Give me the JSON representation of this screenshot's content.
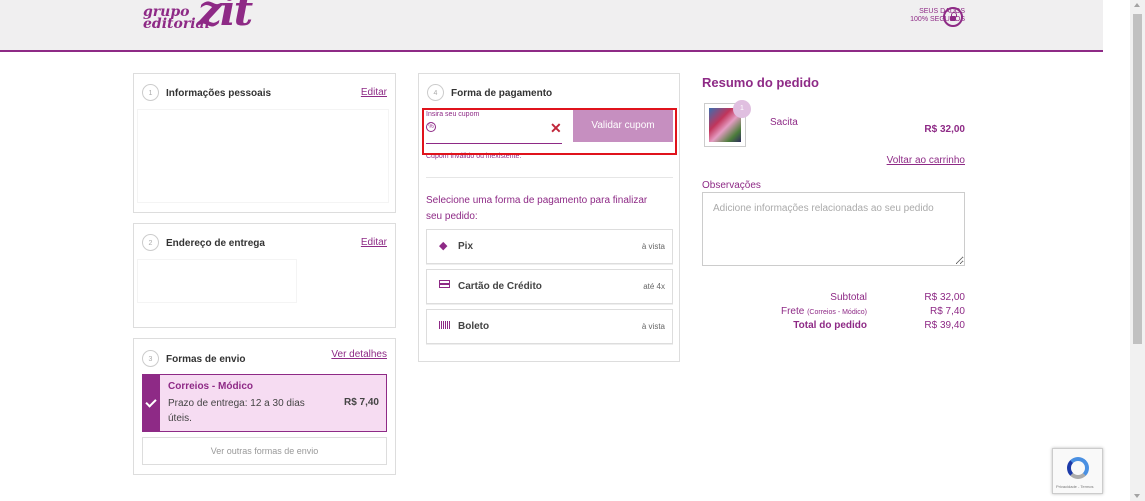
{
  "header": {
    "logo_small_1": "grupo",
    "logo_small_2": "editorial",
    "logo_big": "zit",
    "secure_line1": "SEUS DADOS",
    "secure_line2": "100% SEGUROS"
  },
  "personal": {
    "step": "1",
    "title": "Informações pessoais",
    "edit": "Editar"
  },
  "address": {
    "step": "2",
    "title": "Endereço de entrega",
    "edit": "Editar"
  },
  "shipping": {
    "step": "3",
    "title": "Formas de envio",
    "details": "Ver detalhes",
    "option_name": "Correios - Módico",
    "option_desc": "Prazo de entrega: 12 a 30 dias úteis.",
    "option_price": "R$ 7,40",
    "other": "Ver outras formas de envio"
  },
  "payment": {
    "step": "4",
    "title": "Forma de pagamento",
    "coupon_label": "Insira seu cupom",
    "coupon_value": "",
    "coupon_button": "Validar cupom",
    "coupon_error": "Cupom inválido ou inexistente.",
    "instruction": "Selecione uma forma de pagamento para finalizar seu pedido:",
    "methods": [
      {
        "name": "Pix",
        "note": "à vista",
        "icon": "pix-icon"
      },
      {
        "name": "Cartão de Crédito",
        "note": "até 4x",
        "icon": "credit-card-icon"
      },
      {
        "name": "Boleto",
        "note": "à vista",
        "icon": "barcode-icon"
      }
    ]
  },
  "summary": {
    "title": "Resumo do pedido",
    "product": {
      "name": "Sacita",
      "price": "R$ 32,00",
      "qty": "1"
    },
    "back_link": "Voltar ao carrinho",
    "obs_label": "Observações",
    "obs_placeholder": "Adicione informações relacionadas ao seu pedido",
    "subtotal_label": "Subtotal",
    "subtotal_value": "R$ 32,00",
    "frete_label": "Frete",
    "frete_note": "(Correios - Módico)",
    "frete_value": "R$ 7,40",
    "total_label": "Total do pedido",
    "total_value": "R$ 39,40"
  },
  "recaptcha": {
    "text": "Privacidade - Termos"
  },
  "colors": {
    "brand": "#8e2a86",
    "highlight": "#e0131c",
    "button": "#c68fc0"
  }
}
